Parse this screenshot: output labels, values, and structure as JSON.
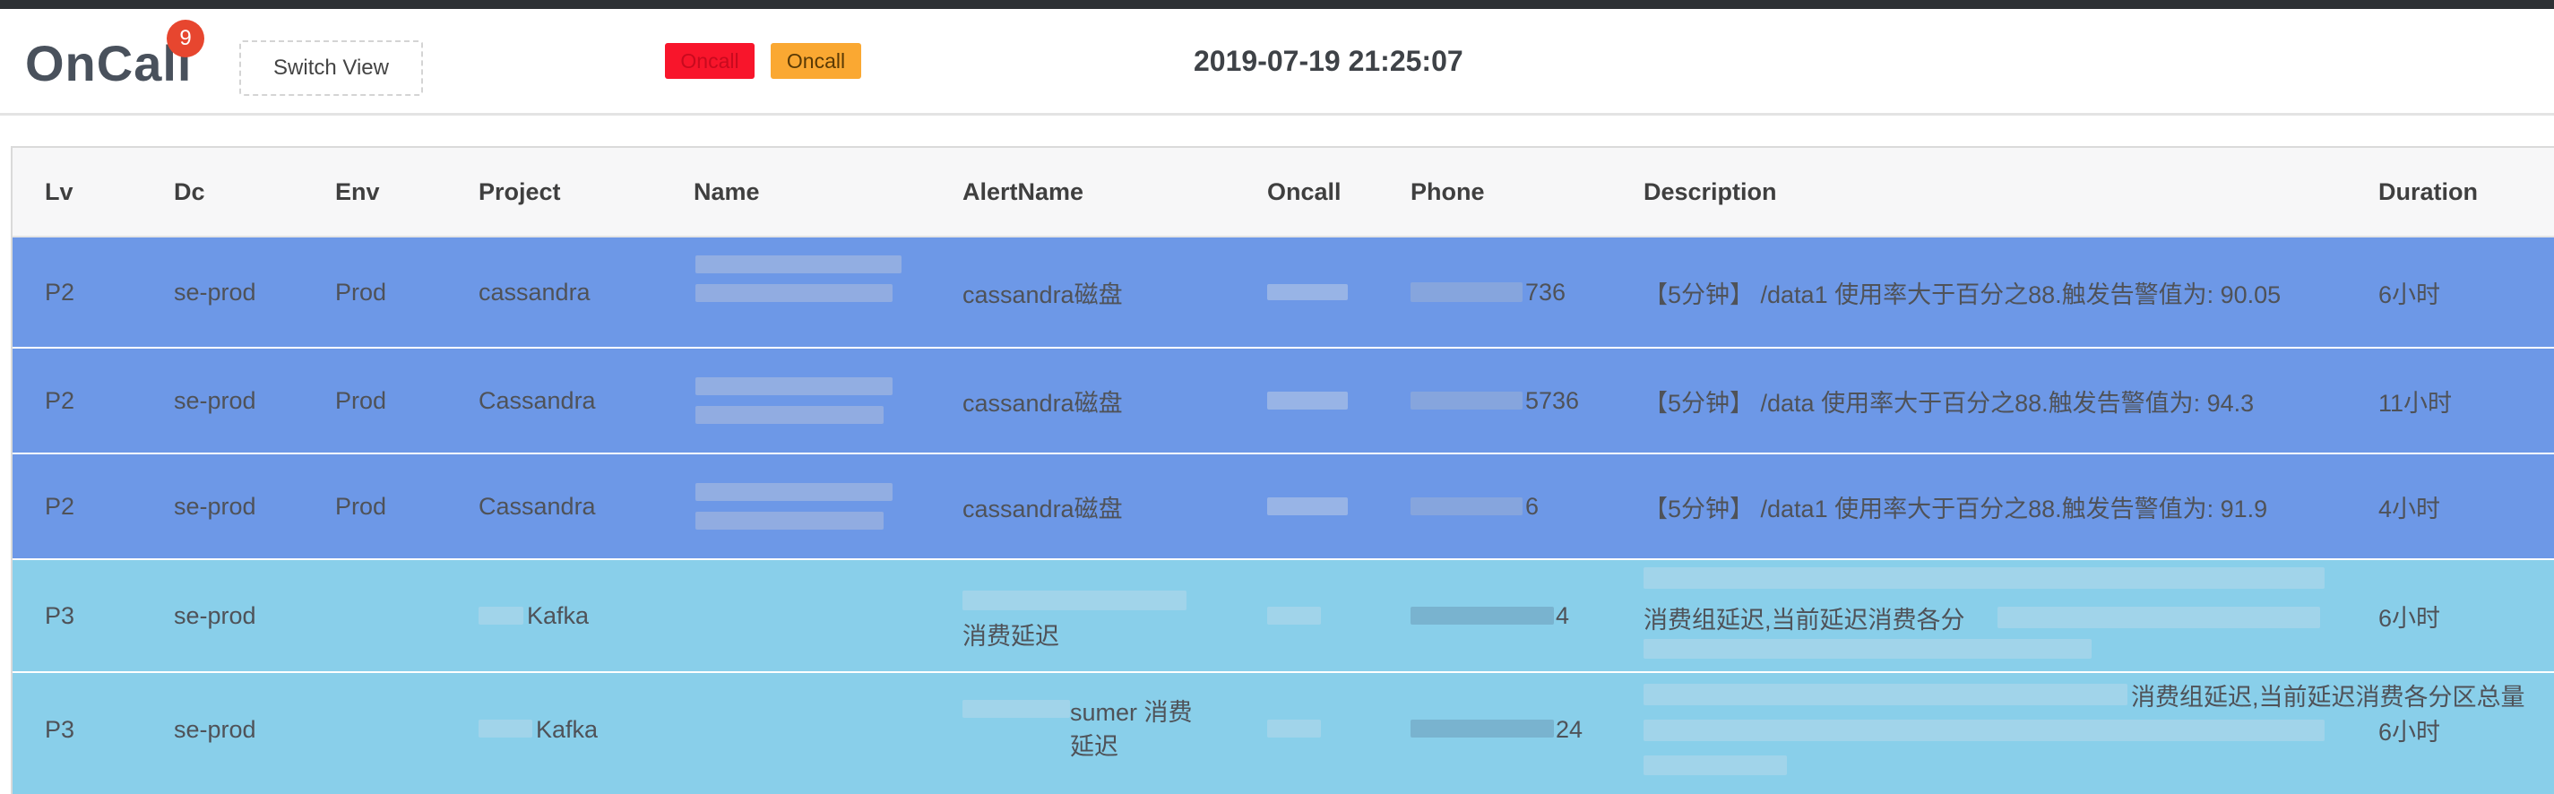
{
  "header": {
    "logo": "OnCall",
    "badge_count": "9",
    "switch_view_label": "Switch View",
    "pill_red_label": "Oncall",
    "pill_orange_label": "Oncall",
    "datetime": "2019-07-19 21:25:07"
  },
  "table": {
    "columns": [
      "Lv",
      "Dc",
      "Env",
      "Project",
      "Name",
      "AlertName",
      "Oncall",
      "Phone",
      "Description",
      "Duration"
    ],
    "rows": [
      {
        "lv": "P2",
        "dc": "se-prod",
        "env": "Prod",
        "project": "cassandra",
        "name": "",
        "alert": "cassandra磁盘",
        "oncall": "",
        "phone": "736",
        "description": "【5分钟】 /data1 使用率大于百分之88.触发告警值为: 90.05",
        "duration": "6小时",
        "level": "P2"
      },
      {
        "lv": "P2",
        "dc": "se-prod",
        "env": "Prod",
        "project": "Cassandra",
        "name": "",
        "alert": "cassandra磁盘",
        "oncall": "",
        "phone": "5736",
        "description": "【5分钟】 /data 使用率大于百分之88.触发告警值为: 94.3",
        "duration": "11小时",
        "level": "P2"
      },
      {
        "lv": "P2",
        "dc": "se-prod",
        "env": "Prod",
        "project": "Cassandra",
        "name": "",
        "alert": "cassandra磁盘",
        "oncall": "",
        "phone": "6",
        "description": "【5分钟】 /data1 使用率大于百分之88.触发告警值为: 91.9",
        "duration": "4小时",
        "level": "P2"
      },
      {
        "lv": "P3",
        "dc": "se-prod",
        "env": "",
        "project": "Kafka",
        "name": "",
        "alert": "消费延迟",
        "oncall": "",
        "phone": "4",
        "description": "消费组延迟,当前延迟消费各分",
        "duration": "6小时",
        "level": "P3"
      },
      {
        "lv": "P3",
        "dc": "se-prod",
        "env": "",
        "project": "Kafka",
        "name": "",
        "alert": "sumer 消费延迟",
        "oncall": "",
        "phone": "24",
        "description": "消费组延迟,当前延迟消费各分区总量",
        "duration": "6小时",
        "level": "P3"
      }
    ]
  },
  "colors": {
    "p2_row": "#6d98e7",
    "p3_row": "#89cfea",
    "badge": "#e7462f",
    "pill_red": "#f8152b",
    "pill_orange": "#faa832"
  }
}
